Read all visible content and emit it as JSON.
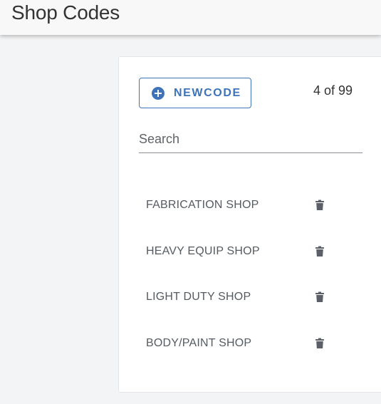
{
  "app_bar": {
    "title": "Shop Codes"
  },
  "toolbar": {
    "new_code_label": "NEWCODE",
    "count_text": "4 of 99"
  },
  "search": {
    "placeholder": "Search",
    "value": ""
  },
  "shops": [
    {
      "label": "FABRICATION SHOP",
      "delete_icon": "trash-icon"
    },
    {
      "label": "HEAVY EQUIP SHOP",
      "delete_icon": "trash-icon"
    },
    {
      "label": "LIGHT DUTY SHOP",
      "delete_icon": "trash-icon"
    },
    {
      "label": "BODY/PAINT SHOP",
      "delete_icon": "trash-icon"
    }
  ],
  "colors": {
    "accent": "#3f73b9",
    "text": "#333333",
    "muted_text": "#555b62",
    "icon": "#5b6068",
    "background": "#f3f4f5"
  }
}
